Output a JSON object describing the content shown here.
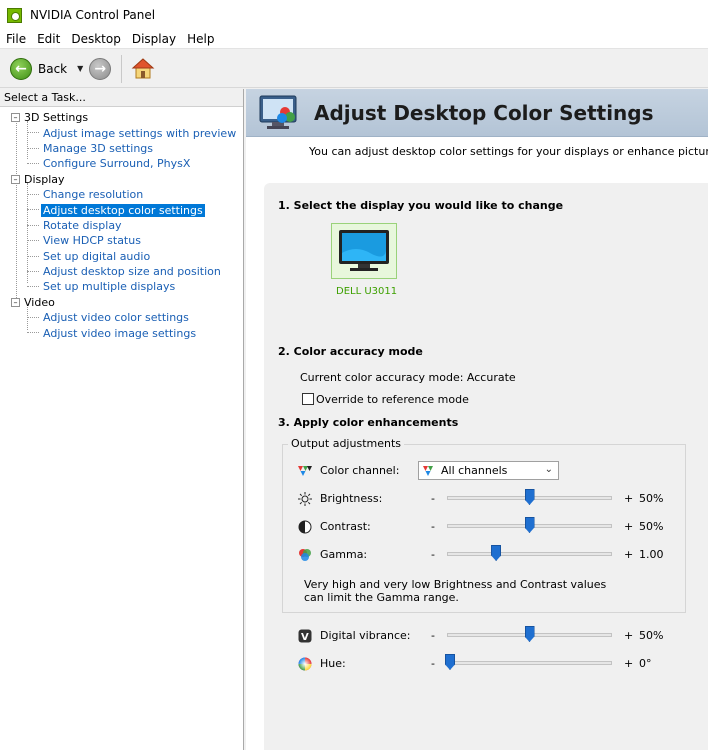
{
  "window": {
    "title": "NVIDIA Control Panel"
  },
  "menubar": {
    "items": [
      "File",
      "Edit",
      "Desktop",
      "Display",
      "Help"
    ]
  },
  "toolbar": {
    "back_label": "Back"
  },
  "sidebar": {
    "header": "Select a Task...",
    "groups": [
      {
        "label": "3D Settings",
        "items": [
          "Adjust image settings with preview",
          "Manage 3D settings",
          "Configure Surround, PhysX"
        ]
      },
      {
        "label": "Display",
        "items": [
          "Change resolution",
          "Adjust desktop color settings",
          "Rotate display",
          "View HDCP status",
          "Set up digital audio",
          "Adjust desktop size and position",
          "Set up multiple displays"
        ]
      },
      {
        "label": "Video",
        "items": [
          "Adjust video color settings",
          "Adjust video image settings"
        ]
      }
    ],
    "selected": "Adjust desktop color settings"
  },
  "page": {
    "title": "Adjust Desktop Color Settings",
    "description": "You can adjust desktop color settings for your displays or enhance picture quality if you a",
    "section1": "1. Select the display you would like to change",
    "display_name": "DELL U3011",
    "section2": "2. Color accuracy mode",
    "current_mode": "Current color accuracy mode: Accurate",
    "override_label": "Override to reference mode",
    "override_checked": false,
    "section3": "3. Apply color enhancements",
    "output_adjustments": "Output adjustments",
    "color_channel_label": "Color channel:",
    "color_channel_value": "All channels",
    "note": "Very high and very low Brightness and Contrast values can limit the Gamma range.",
    "sliders": {
      "brightness": {
        "label": "Brightness:",
        "minus": "-",
        "plus": "+",
        "value": "50%",
        "fraction": 0.5
      },
      "contrast": {
        "label": "Contrast:",
        "minus": "-",
        "plus": "+",
        "value": "50%",
        "fraction": 0.5
      },
      "gamma": {
        "label": "Gamma:",
        "minus": "-",
        "plus": "+",
        "value": "1.00",
        "fraction": 0.29
      },
      "vibrance": {
        "label": "Digital vibrance:",
        "minus": "-",
        "plus": "+",
        "value": "50%",
        "fraction": 0.5
      },
      "hue": {
        "label": "Hue:",
        "minus": "-",
        "plus": "+",
        "value": "0°",
        "fraction": 0.0
      }
    }
  },
  "colors": {
    "accent": "#76b900",
    "selection": "#0078d7",
    "link": "#1a5fb4",
    "slider_thumb": "#1f6fd0"
  }
}
